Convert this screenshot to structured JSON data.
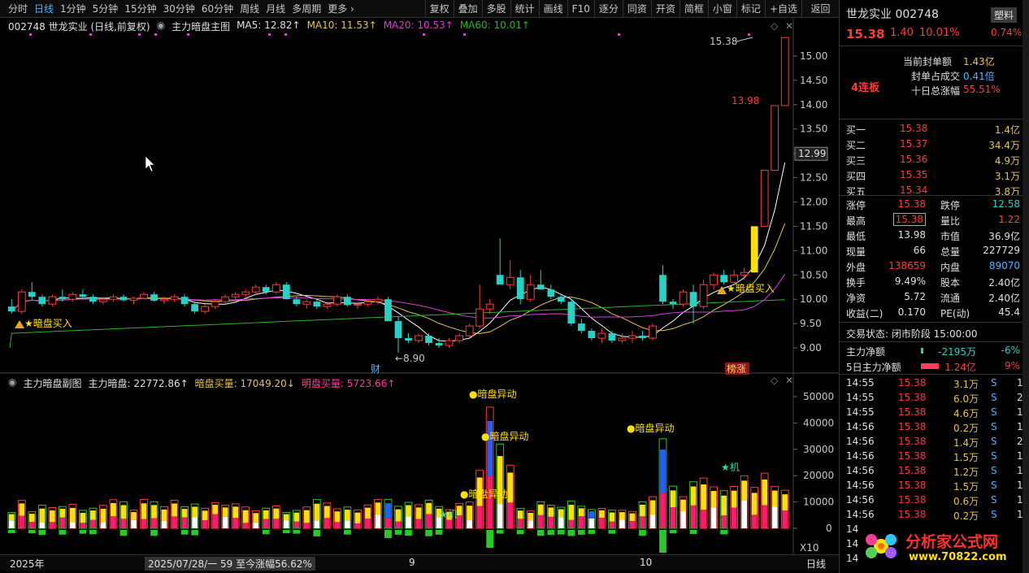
{
  "toolbar": {
    "periods": [
      "分时",
      "日线",
      "1分钟",
      "5分钟",
      "15分钟",
      "30分钟",
      "60分钟",
      "周线",
      "月线",
      "多周期",
      "更多 ›"
    ],
    "active_index": 1,
    "buttons": [
      "复权",
      "叠加",
      "多股",
      "统计",
      "画线",
      "F10",
      "逐分",
      "同资",
      "开资",
      "简框",
      "小窗",
      "标记",
      "+自选"
    ],
    "back_label": "返回"
  },
  "main_legend": {
    "code_name": "002748 世龙实业 (日线,前复权)",
    "indicator": "主力暗盘主图",
    "ma5": "MA5: 12.82↑",
    "ma10": "MA10: 11.53↑",
    "ma20": "MA20: 10.53↑",
    "ma60": "MA60: 10.01↑"
  },
  "sub_legend": {
    "indicator": "主力暗盘副图",
    "main_value": "主力暗盘: 22772.86↑",
    "dark_buy": "暗盘买量: 17049.20↓",
    "light_buy": "明盘买量: 5723.66↑"
  },
  "annotations": {
    "high_label": "15.38",
    "low_label": "8.90",
    "mid_label": "13.98",
    "buy_signal_1": "暗盘买入",
    "buy_signal_2": "暗盘买入",
    "cai_label": "财",
    "bang_label": "榜涨",
    "abnormal_1": "暗盘异动",
    "abnormal_2": "暗盘异动",
    "abnormal_3": "暗盘异动",
    "abnormal_4": "暗盘异动",
    "ji_1": "★机",
    "ji_2": "★机",
    "price_marker": "12.99",
    "x10": "X10"
  },
  "price_axis": [
    "15.00",
    "14.50",
    "14.00",
    "13.50",
    "13.00",
    "12.50",
    "12.00",
    "11.50",
    "11.00",
    "10.50",
    "10.00",
    "9.50",
    "9.00"
  ],
  "volume_axis": [
    "50000",
    "40000",
    "30000",
    "20000",
    "10000",
    "0"
  ],
  "time_bar": {
    "year": "2025年",
    "range": "2025/07/28/一 59 至今涨幅56.62%",
    "month_9": "9",
    "month_10": "10",
    "period": "日线"
  },
  "stock": {
    "name_code": "世龙实业 002748",
    "tag": "塑料",
    "price": "15.38",
    "change": "1.40",
    "change_pct": "10.01%",
    "tag_pct": "0.74%",
    "streak": "4连板",
    "seal_label": "当前封单额",
    "seal_value": "1.43亿",
    "seal_ratio_label": "封单占成交",
    "seal_ratio_value": "0.41倍",
    "ten_day_label": "十日总涨幅",
    "ten_day_value": "55.51%"
  },
  "bids": [
    {
      "label": "买一",
      "price": "15.38",
      "vol": "1.4亿"
    },
    {
      "label": "买二",
      "price": "15.37",
      "vol": "34.4万"
    },
    {
      "label": "买三",
      "price": "15.36",
      "vol": "4.9万"
    },
    {
      "label": "买四",
      "price": "15.35",
      "vol": "3.1万"
    },
    {
      "label": "买五",
      "price": "15.34",
      "vol": "3.8万"
    }
  ],
  "quote": [
    {
      "l1": "涨停",
      "v1": "15.38",
      "l2": "跌停",
      "v2": "12.58"
    },
    {
      "l1": "最高",
      "v1": "15.38",
      "l2": "量比",
      "v2": "1.22"
    },
    {
      "l1": "最低",
      "v1": "13.98",
      "l2": "市值",
      "v2": "36.9亿"
    },
    {
      "l1": "现量",
      "v1": "66",
      "l2": "总量",
      "v2": "227729"
    },
    {
      "l1": "外盘",
      "v1": "138659",
      "l2": "内盘",
      "v2": "89070"
    },
    {
      "l1": "换手",
      "v1": "9.49%",
      "l2": "股本",
      "v2": "2.40亿"
    },
    {
      "l1": "净资",
      "v1": "5.72",
      "l2": "流通",
      "v2": "2.40亿"
    },
    {
      "l1": "收益(二)",
      "v1": "0.170",
      "l2": "PE(动)",
      "v2": "45.4"
    }
  ],
  "status": "交易状态: 闭市阶段 15:00:00",
  "flow": [
    {
      "label": "主力净额",
      "value": "-2195万",
      "pct": "-6%"
    },
    {
      "label": "5日主力净额",
      "value": "1.24亿",
      "pct": "9%"
    }
  ],
  "ticks": [
    {
      "time": "14:55",
      "price": "15.38",
      "vol": "3.1万",
      "side": "S",
      "n": "1"
    },
    {
      "time": "14:55",
      "price": "15.38",
      "vol": "6.0万",
      "side": "S",
      "n": "2"
    },
    {
      "time": "14:55",
      "price": "15.38",
      "vol": "4.6万",
      "side": "S",
      "n": "1"
    },
    {
      "time": "14:56",
      "price": "15.38",
      "vol": "0.2万",
      "side": "S",
      "n": "1"
    },
    {
      "time": "14:56",
      "price": "15.38",
      "vol": "1.4万",
      "side": "S",
      "n": "2"
    },
    {
      "time": "14:56",
      "price": "15.38",
      "vol": "1.5万",
      "side": "S",
      "n": "1"
    },
    {
      "time": "14:56",
      "price": "15.38",
      "vol": "1.2万",
      "side": "S",
      "n": "1"
    },
    {
      "time": "14:56",
      "price": "15.38",
      "vol": "1.5万",
      "side": "S",
      "n": "1"
    },
    {
      "time": "14:56",
      "price": "15.38",
      "vol": "0.6万",
      "side": "S",
      "n": "1"
    },
    {
      "time": "14:56",
      "price": "15.38",
      "vol": "0.2万",
      "side": "S",
      "n": "1"
    },
    {
      "time": "14",
      "price": "",
      "vol": "",
      "side": "",
      "n": ""
    },
    {
      "time": "14",
      "price": "",
      "vol": "",
      "side": "",
      "n": ""
    },
    {
      "time": "14",
      "price": "",
      "vol": "",
      "side": "",
      "n": ""
    }
  ],
  "watermark": {
    "title": "分析家公式网",
    "url": "www.70822.com"
  },
  "colors": {
    "up": "#ff3b3b",
    "down": "#24d3c6",
    "ma5": "#ffffff",
    "ma10": "#e6c34a",
    "ma20": "#d63fd6",
    "ma60": "#28b428",
    "dark_bar": "#ffe000",
    "light_bar": "#ff1a6e",
    "blue_bar": "#2060ff"
  },
  "chart_data": {
    "type": "candlestick",
    "price_range": [
      8.8,
      15.4
    ],
    "candles": [
      [
        9.85,
        10.0,
        9.7,
        9.75
      ],
      [
        9.75,
        10.2,
        9.7,
        10.15
      ],
      [
        10.15,
        10.35,
        10.0,
        10.05
      ],
      [
        10.05,
        10.1,
        9.85,
        9.9
      ],
      [
        9.9,
        10.1,
        9.85,
        10.05
      ],
      [
        10.05,
        10.2,
        9.95,
        10.0
      ],
      [
        10.0,
        10.15,
        9.95,
        10.1
      ],
      [
        10.1,
        10.2,
        10.0,
        10.05
      ],
      [
        10.05,
        10.1,
        9.9,
        9.95
      ],
      [
        9.95,
        10.05,
        9.9,
        10.0
      ],
      [
        10.0,
        10.1,
        9.95,
        10.05
      ],
      [
        10.05,
        10.1,
        9.95,
        9.98
      ],
      [
        9.98,
        10.05,
        9.9,
        10.02
      ],
      [
        10.02,
        10.15,
        10.0,
        10.1
      ],
      [
        10.1,
        10.15,
        9.95,
        9.97
      ],
      [
        9.97,
        10.05,
        9.9,
        10.0
      ],
      [
        10.0,
        10.1,
        9.95,
        10.05
      ],
      [
        10.05,
        10.1,
        9.85,
        9.9
      ],
      [
        9.9,
        9.95,
        9.7,
        9.75
      ],
      [
        9.75,
        9.9,
        9.7,
        9.85
      ],
      [
        9.85,
        10.0,
        9.8,
        9.95
      ],
      [
        9.95,
        10.1,
        9.9,
        10.05
      ],
      [
        10.05,
        10.15,
        10.0,
        10.1
      ],
      [
        10.1,
        10.2,
        10.05,
        10.15
      ],
      [
        10.15,
        10.3,
        10.1,
        10.25
      ],
      [
        10.25,
        10.3,
        10.1,
        10.15
      ],
      [
        10.15,
        10.35,
        10.1,
        10.3
      ],
      [
        10.3,
        10.35,
        10.05,
        10.0
      ],
      [
        10.0,
        10.05,
        9.85,
        9.9
      ],
      [
        9.9,
        10.0,
        9.8,
        9.95
      ],
      [
        9.95,
        10.0,
        9.8,
        9.85
      ],
      [
        9.85,
        9.95,
        9.8,
        9.9
      ],
      [
        9.9,
        10.1,
        9.85,
        10.05
      ],
      [
        10.05,
        10.1,
        9.85,
        9.88
      ],
      [
        9.88,
        9.95,
        9.8,
        9.9
      ],
      [
        9.9,
        10.0,
        9.85,
        9.95
      ],
      [
        9.95,
        10.05,
        9.9,
        10.0
      ],
      [
        10.0,
        10.05,
        9.7,
        9.55
      ],
      [
        9.55,
        9.65,
        8.9,
        9.2
      ],
      [
        9.2,
        9.3,
        9.1,
        9.15
      ],
      [
        9.15,
        9.3,
        9.1,
        9.25
      ],
      [
        9.25,
        9.3,
        9.05,
        9.1
      ],
      [
        9.1,
        9.2,
        9.0,
        9.05
      ],
      [
        9.05,
        9.2,
        9.0,
        9.15
      ],
      [
        9.15,
        9.3,
        9.1,
        9.25
      ],
      [
        9.25,
        9.5,
        9.2,
        9.45
      ],
      [
        9.45,
        10.3,
        9.4,
        9.8
      ],
      [
        9.8,
        10.0,
        9.7,
        9.9
      ],
      [
        10.5,
        11.25,
        10.4,
        10.3
      ],
      [
        10.3,
        10.8,
        10.2,
        10.45
      ],
      [
        10.45,
        10.6,
        9.9,
        10.0
      ],
      [
        10.0,
        10.5,
        9.95,
        10.3
      ],
      [
        10.3,
        10.6,
        10.2,
        10.2
      ],
      [
        10.2,
        10.3,
        10.0,
        10.05
      ],
      [
        10.05,
        10.1,
        9.9,
        9.95
      ],
      [
        9.95,
        10.0,
        9.45,
        9.5
      ],
      [
        9.5,
        9.6,
        9.3,
        9.35
      ],
      [
        9.35,
        9.4,
        9.15,
        9.2
      ],
      [
        9.2,
        9.4,
        9.1,
        9.3
      ],
      [
        9.3,
        9.35,
        9.1,
        9.15
      ],
      [
        9.15,
        9.3,
        9.1,
        9.2
      ],
      [
        9.2,
        9.35,
        9.1,
        9.25
      ],
      [
        9.25,
        9.35,
        9.15,
        9.2
      ],
      [
        9.2,
        9.5,
        9.15,
        9.45
      ],
      [
        10.5,
        10.7,
        9.9,
        9.95
      ],
      [
        9.95,
        10.0,
        9.8,
        9.9
      ],
      [
        9.9,
        10.2,
        9.85,
        10.15
      ],
      [
        10.15,
        10.3,
        9.5,
        9.85
      ],
      [
        9.85,
        10.4,
        9.8,
        10.3
      ],
      [
        10.3,
        10.55,
        10.2,
        10.5
      ],
      [
        10.5,
        10.6,
        10.3,
        10.35
      ],
      [
        10.35,
        10.6,
        10.3,
        10.5
      ],
      [
        10.5,
        10.65,
        10.4,
        10.55
      ],
      [
        10.55,
        11.5,
        10.55,
        11.5
      ],
      [
        11.5,
        12.65,
        11.5,
        12.65
      ],
      [
        12.65,
        13.98,
        12.65,
        13.98
      ],
      [
        13.98,
        15.38,
        13.98,
        15.38
      ]
    ],
    "volume_range": [
      0,
      50000
    ]
  }
}
